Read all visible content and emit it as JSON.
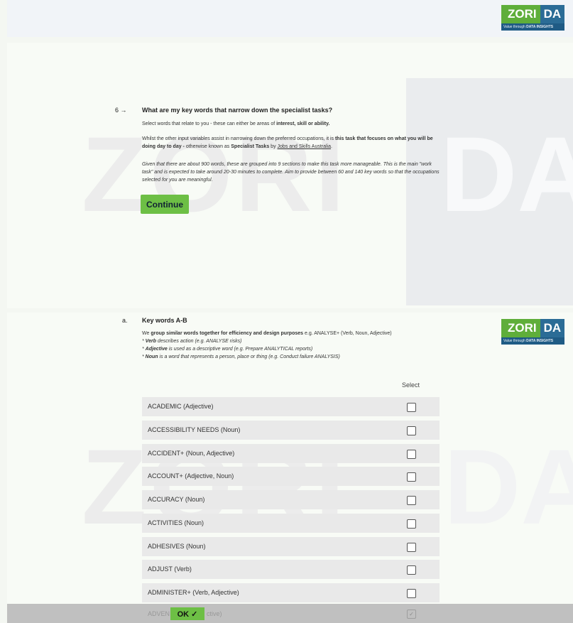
{
  "logo": {
    "zori": "ZORI",
    "da": "DA",
    "tagline_prefix": "Value through",
    "tagline_strong": "DATA INSIGHTS",
    "icon": "zorida-logo"
  },
  "watermark": {
    "zori": "ZORI",
    "da": "DA"
  },
  "question": {
    "number": "6 →",
    "title": "What are my key words that narrow down the specialist tasks?",
    "p1_a": "Select words that relate to you - these can either be areas of ",
    "p1_b": "interest, skill or ability.",
    "p2_a": "Whilst the other input variables assist in narrowing down the preferred occupations, it is ",
    "p2_b": "this task that focuses on what you will be doing day to day -",
    "p2_c": " otherwise known as ",
    "p2_d": "Specialist Tasks",
    "p2_e": " by ",
    "p2_f": "Jobs and Skills Australia",
    "p2_g": ".",
    "p3": "Given that there are about 900 words, these are grouped into 9 sections to make this task more manageable. This is the main \"work task\" and is expected to take around 20-30 minutes to complete. Aim to provide between 60 and 140 key words so that the occupations selected for you are meaningful.",
    "continue_label": "Continue"
  },
  "keywords": {
    "letter": "a.",
    "title": "Key words A-B",
    "intro_a": "We ",
    "intro_b": "group similar words together for efficiency and design purposes",
    "intro_c": " e.g. ANALYSE+ (Verb, Noun, Adjective)",
    "verb_a": "* ",
    "verb_b": "Verb",
    "verb_c": " describes action (e.g. ANALYSE risks)",
    "adj_a": "* ",
    "adj_b": "Adjective",
    "adj_c": " is used as a descriptive word (e.g. Prepare ANALYTICAL reports)",
    "noun_a": "* ",
    "noun_b": "Noun",
    "noun_c": " is a word that represents a person, place or thing (e.g. Conduct failure ANALYSIS)",
    "select_header": "Select",
    "rows": [
      "ACADEMIC (Adjective)",
      "ACCESSIBILITY NEEDS (Noun)",
      "ACCIDENT+ (Noun, Adjective)",
      "ACCOUNT+ (Adjective, Noun)",
      "ACCURACY (Noun)",
      "ACTIVITIES (Noun)",
      "ADHESIVES (Noun)",
      "ADJUST (Verb)",
      "ADMINISTER+ (Verb, Adjective)"
    ],
    "last_row_visible": "ADVEN",
    "last_row_tail": "ctive)"
  },
  "ok_button": {
    "label": "OK",
    "check": "✓"
  }
}
